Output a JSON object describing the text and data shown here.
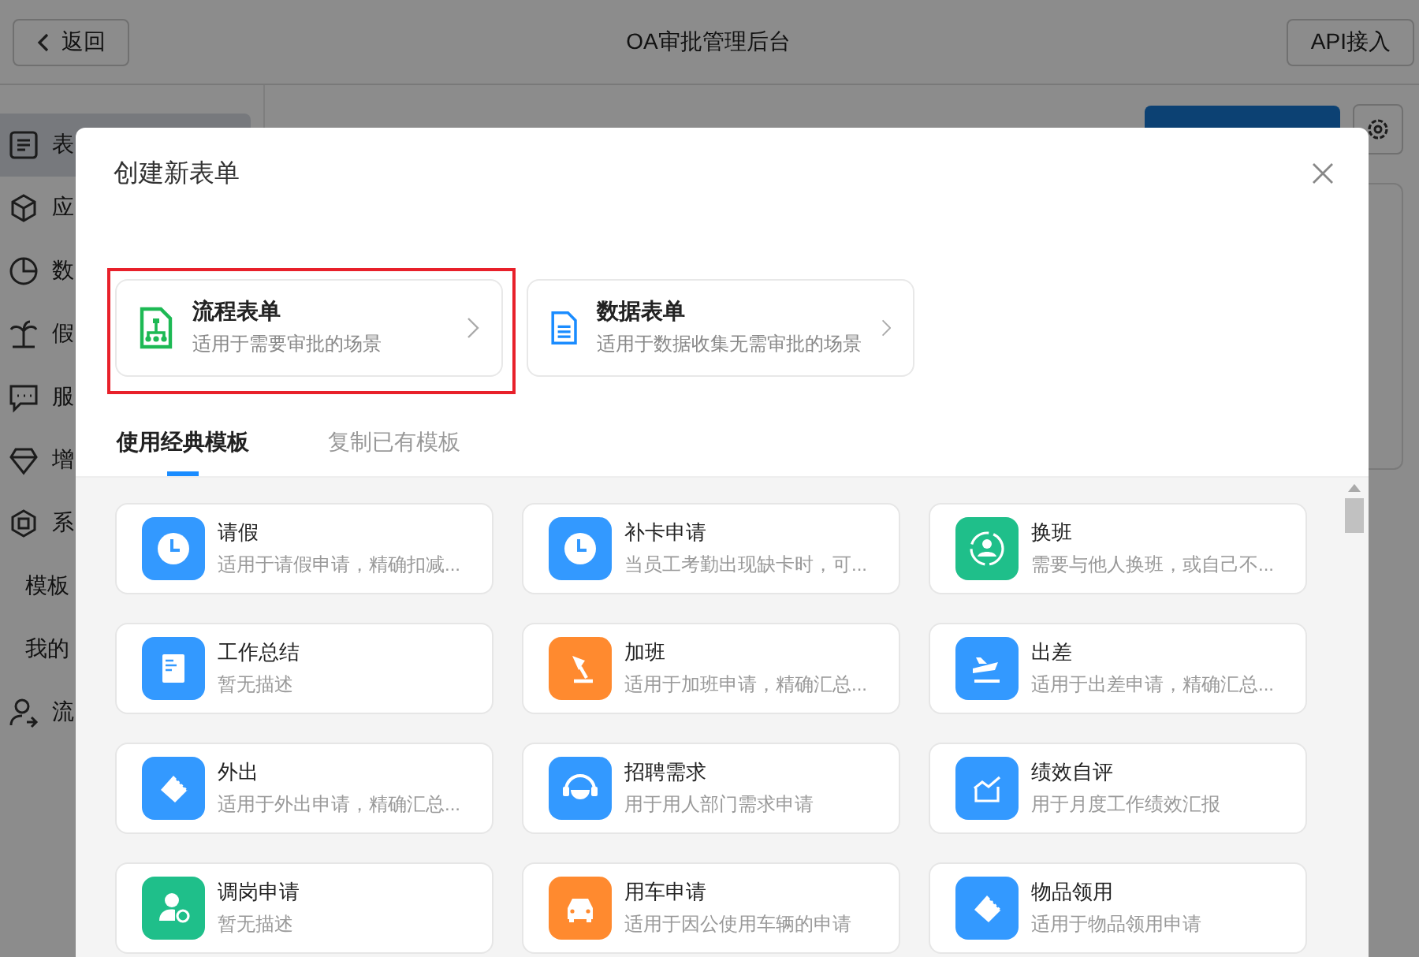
{
  "header": {
    "back": "返回",
    "title": "OA审批管理后台",
    "api_button": "API接入"
  },
  "sidebar": {
    "items": [
      {
        "label": "表",
        "selected": true
      },
      {
        "label": "应",
        "selected": false
      },
      {
        "label": "数",
        "selected": false
      },
      {
        "label": "假",
        "selected": false
      },
      {
        "label": "服",
        "selected": false
      },
      {
        "label": "增",
        "selected": false
      },
      {
        "label": "系",
        "selected": false
      },
      {
        "label": "模板",
        "selected": false
      },
      {
        "label": "我的",
        "selected": false
      },
      {
        "label": "流",
        "selected": false
      }
    ]
  },
  "dialog": {
    "title": "创建新表单",
    "form_types": [
      {
        "kind": "flow",
        "title": "流程表单",
        "desc": "适用于需要审批的场景",
        "highlighted": true
      },
      {
        "kind": "data",
        "title": "数据表单",
        "desc": "适用于数据收集无需审批的场景",
        "highlighted": false
      }
    ],
    "tabs": [
      {
        "label": "使用经典模板",
        "selected": true
      },
      {
        "label": "复制已有模板",
        "selected": false
      }
    ],
    "templates": [
      {
        "kind": "clock",
        "color": "#3399ff",
        "name": "请假",
        "desc": "适用于请假申请，精确扣减..."
      },
      {
        "kind": "clock",
        "color": "#3399ff",
        "name": "补卡申请",
        "desc": "当员工考勤出现缺卡时，可..."
      },
      {
        "kind": "swap",
        "color": "#1fbf8a",
        "name": "换班",
        "desc": "需要与他人换班，或自己不..."
      },
      {
        "kind": "doc",
        "color": "#3399ff",
        "name": "工作总结",
        "desc": "暂无描述"
      },
      {
        "kind": "lamp",
        "color": "#ff8a2f",
        "name": "加班",
        "desc": "适用于加班申请，精确汇总..."
      },
      {
        "kind": "plane",
        "color": "#3399ff",
        "name": "出差",
        "desc": "适用于出差申请，精确汇总..."
      },
      {
        "kind": "tag",
        "color": "#3399ff",
        "name": "外出",
        "desc": "适用于外出申请，精确汇总..."
      },
      {
        "kind": "headset",
        "color": "#3399ff",
        "name": "招聘需求",
        "desc": "用于用人部门需求申请"
      },
      {
        "kind": "chart",
        "color": "#3399ff",
        "name": "绩效自评",
        "desc": "用于月度工作绩效汇报"
      },
      {
        "kind": "person",
        "color": "#1fbf8a",
        "name": "调岗申请",
        "desc": "暂无描述"
      },
      {
        "kind": "car",
        "color": "#ff8a2f",
        "name": "用车申请",
        "desc": "适用于因公使用车辆的申请"
      },
      {
        "kind": "tag",
        "color": "#3399ff",
        "name": "物品领用",
        "desc": "适用于物品领用申请"
      }
    ]
  }
}
